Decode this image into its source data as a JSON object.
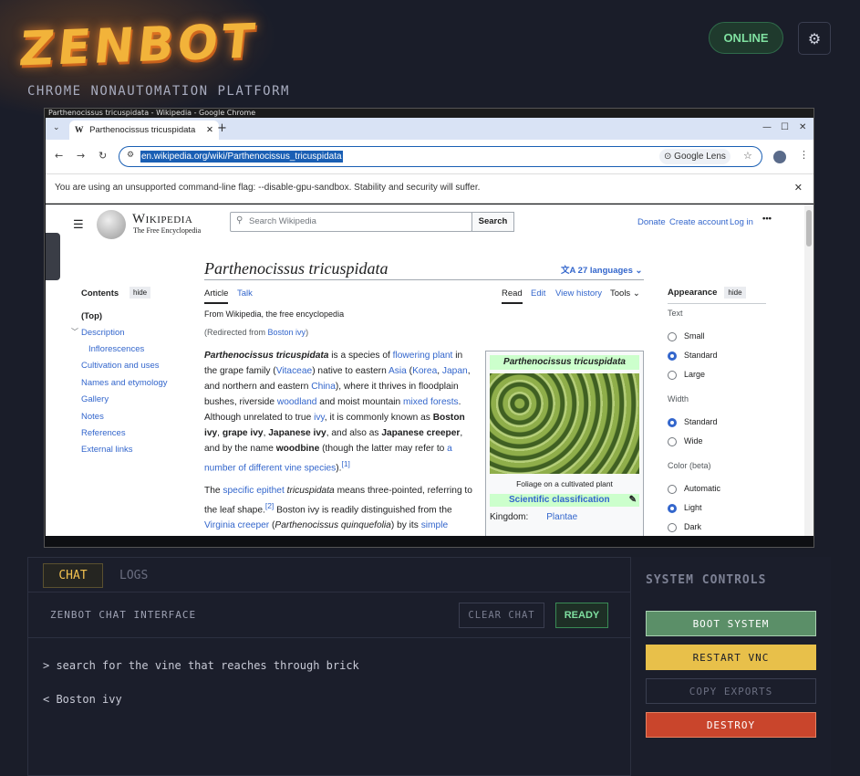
{
  "header": {
    "logo": "ZENBOT",
    "subtitle": "CHROME NONAUTOMATION PLATFORM",
    "status": "ONLINE",
    "settings_icon": "gear-icon"
  },
  "browser": {
    "window_title": "Parthenocissus tricuspidata - Wikipedia - Google Chrome",
    "tab_title": "Parthenocissus tricuspidata",
    "url": "en.wikipedia.org/wiki/Parthenocissus_tricuspidata",
    "lens_label": "Google Lens",
    "infobar": "You are using an unsupported command-line flag: --disable-gpu-sandbox. Stability and security will suffer."
  },
  "wiki": {
    "wordmark": "Wikipedia",
    "tagline": "The Free Encyclopedia",
    "search_placeholder": "Search Wikipedia",
    "search_button": "Search",
    "top_links": [
      "Donate",
      "Create account",
      "Log in"
    ],
    "title": "Parthenocissus tricuspidata",
    "languages": "27 languages",
    "tabs_left": [
      "Article",
      "Talk"
    ],
    "tabs_right": [
      "Read",
      "Edit",
      "View history",
      "Tools"
    ],
    "from": "From Wikipedia, the free encyclopedia",
    "redirected_prefix": "(Redirected from ",
    "redirected_link": "Boston ivy",
    "redirected_suffix": ")",
    "contents_label": "Contents",
    "hide_label": "hide",
    "toc": [
      "(Top)",
      "Description",
      "Inflorescences",
      "Cultivation and uses",
      "Names and etymology",
      "Gallery",
      "Notes",
      "References",
      "External links"
    ],
    "para1_html": "<b><i>Parthenocissus tricuspidata</i></b> is a species of <a>flowering plant</a> in the grape family (<a>Vitaceae</a>) native to eastern <a>Asia</a> (<a>Korea</a>, <a>Japan</a>, and northern and eastern <a>China</a>), where it thrives in floodplain bushes, riverside <a>woodland</a> and moist mountain <a>mixed forests</a>. Although unrelated to true <a>ivy</a>, it is commonly known as <b>Boston ivy</b>, <b>grape ivy</b>, <b>Japanese ivy</b>, and also as <b>Japanese creeper</b>, and by the name <b>woodbine</b> (though the latter may refer to <a>a number of different vine species</a>).<sup><a>[1]</a></sup>",
    "para2_html": "The <a>specific epithet</a> <i>tricuspidata</i> means three-pointed, referring to the leaf shape.<sup><a>[2]</a></sup> Boston ivy is readily distinguished from the <a>Virginia creeper</a> (<i>Parthenocissus quinquefolia</i>) by its <a>simple</a>",
    "infobox": {
      "title": "Parthenocissus tricuspidata",
      "caption": "Foliage on a cultivated plant",
      "classification": "Scientific classification",
      "kingdom_label": "Kingdom:",
      "kingdom_value": "Plantae"
    },
    "appearance": {
      "title": "Appearance",
      "text_label": "Text",
      "text_options": [
        "Small",
        "Standard",
        "Large"
      ],
      "width_label": "Width",
      "width_options": [
        "Standard",
        "Wide"
      ],
      "color_label": "Color (beta)",
      "color_options": [
        "Automatic",
        "Light",
        "Dark"
      ]
    }
  },
  "chat": {
    "tabs": [
      "CHAT",
      "LOGS"
    ],
    "title": "ZENBOT CHAT INTERFACE",
    "clear_label": "CLEAR CHAT",
    "status": "READY",
    "messages": [
      "> search for the vine that reaches through brick",
      "< Boston ivy"
    ]
  },
  "controls": {
    "title": "SYSTEM CONTROLS",
    "buttons": [
      {
        "label": "BOOT SYSTEM",
        "color": "#5b8f68"
      },
      {
        "label": "RESTART VNC",
        "color": "#e8c04a"
      },
      {
        "label": "COPY EXPORTS",
        "color": "#1b1e2b"
      },
      {
        "label": "DESTROY",
        "color": "#c9452c"
      }
    ]
  }
}
